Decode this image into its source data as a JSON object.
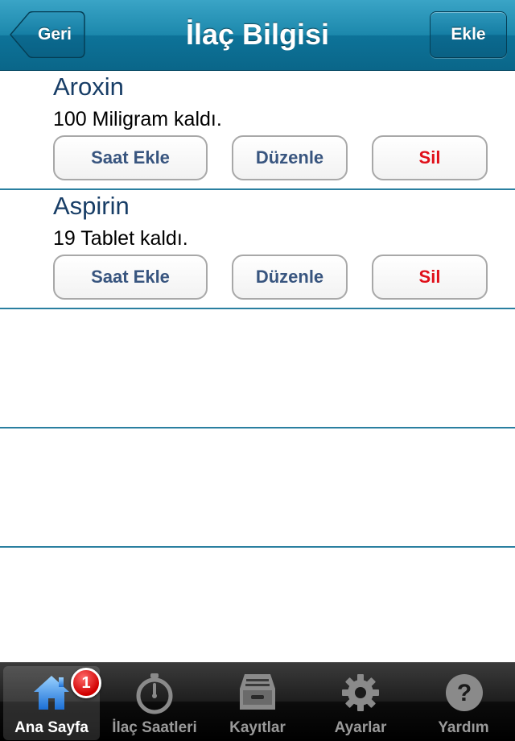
{
  "nav": {
    "title": "İlaç Bilgisi",
    "back_label": "Geri",
    "add_label": "Ekle"
  },
  "medications": [
    {
      "name": "Aroxin",
      "remaining": "100 Miligram kaldı.",
      "add_hour_label": "Saat Ekle",
      "edit_label": "Düzenle",
      "delete_label": "Sil"
    },
    {
      "name": "Aspirin",
      "remaining": "19 Tablet kaldı.",
      "add_hour_label": "Saat Ekle",
      "edit_label": "Düzenle",
      "delete_label": "Sil"
    }
  ],
  "tabbar": {
    "tabs": [
      {
        "label": "Ana Sayfa",
        "icon": "home-icon",
        "active": true,
        "badge": "1"
      },
      {
        "label": "İlaç Saatleri",
        "icon": "stopwatch-icon",
        "active": false
      },
      {
        "label": "Kayıtlar",
        "icon": "archive-icon",
        "active": false
      },
      {
        "label": "Ayarlar",
        "icon": "gear-icon",
        "active": false
      },
      {
        "label": "Yardım",
        "icon": "help-icon",
        "active": false
      }
    ]
  },
  "colors": {
    "nav_bar": "#1c88ac",
    "med_name": "#173d66",
    "button_text": "#38557f",
    "delete_text": "#e0101a",
    "separator": "#2a7fa0",
    "badge": "#d00000"
  }
}
